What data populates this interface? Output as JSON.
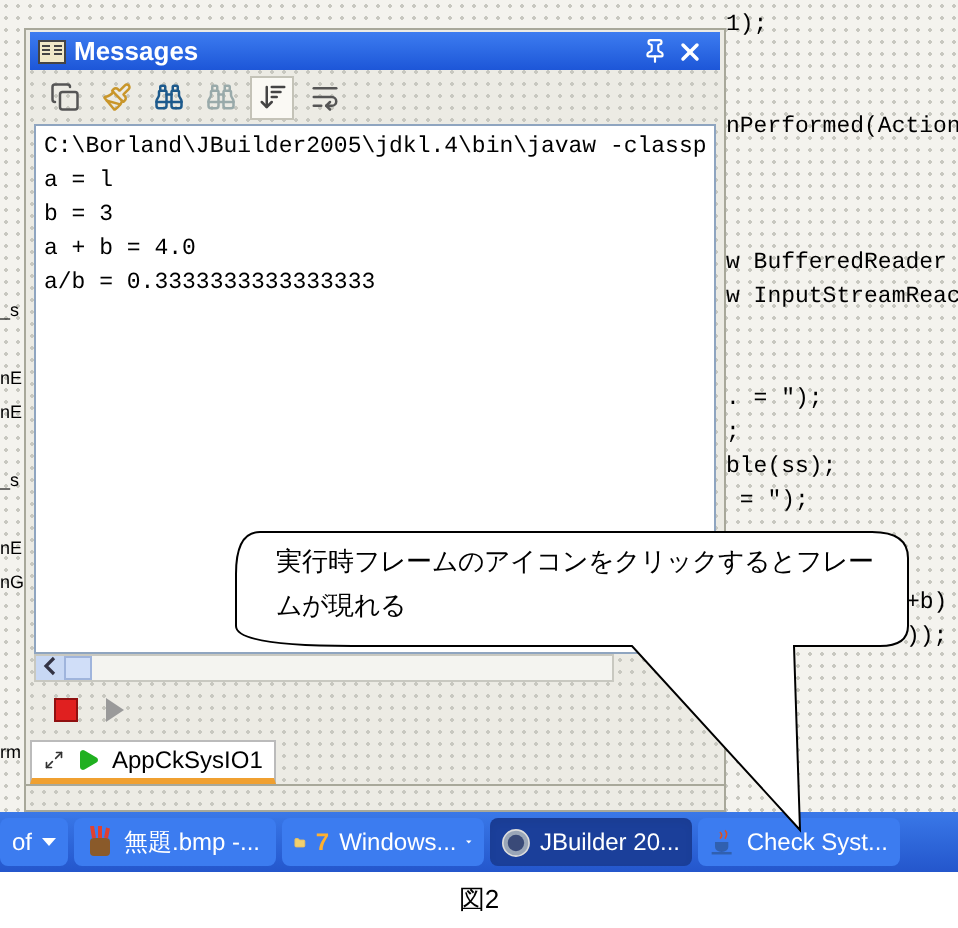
{
  "background_code": {
    "left_lines": [
      {
        "kind": "code",
        "text": "_s"
      },
      {
        "kind": "blank"
      },
      {
        "kind": "code",
        "text": "nE"
      },
      {
        "kind": "code",
        "text": "nE"
      },
      {
        "kind": "blank"
      },
      {
        "kind": "code",
        "text": "_s"
      },
      {
        "kind": "blank"
      },
      {
        "kind": "code",
        "text": "nE"
      },
      {
        "kind": "code",
        "text": "nG"
      },
      {
        "kind": "blank"
      },
      {
        "kind": "blank"
      },
      {
        "kind": "blank"
      },
      {
        "kind": "blank"
      },
      {
        "kind": "code",
        "text": "rm"
      }
    ],
    "right_lines": [
      {
        "kind": "code",
        "text": "1);"
      },
      {
        "kind": "blank"
      },
      {
        "kind": "blank"
      },
      {
        "kind": "code",
        "text": "nPerformed(Action"
      },
      {
        "kind": "blank"
      },
      {
        "kind": "blank"
      },
      {
        "kind": "blank"
      },
      {
        "kind": "code",
        "text": "w BufferedReader"
      },
      {
        "kind": "code",
        "text": "w InputStreamReac"
      },
      {
        "kind": "blank"
      },
      {
        "kind": "blank"
      },
      {
        "kind": "code",
        "text": ". = \");"
      },
      {
        "kind": "code",
        "text": ";"
      },
      {
        "kind": "code",
        "text": "ble(ss);"
      },
      {
        "kind": "code",
        "text": " = \");"
      },
      {
        "kind": "blank"
      },
      {
        "kind": "blank"
      },
      {
        "kind": "code",
        "text": "+b)",
        "behind_callout": true
      },
      {
        "kind": "code",
        "text": "));",
        "behind_callout": true
      }
    ]
  },
  "messages_window": {
    "title": "Messages",
    "toolbar": [
      {
        "kind": "copy",
        "selected": false
      },
      {
        "kind": "clear",
        "selected": false
      },
      {
        "kind": "find",
        "selected": false
      },
      {
        "kind": "find-next",
        "selected": false
      },
      {
        "kind": "sort",
        "selected": true
      },
      {
        "kind": "wrap",
        "selected": false
      }
    ],
    "output_lines": [
      "C:\\Borland\\JBuilder2005\\jdkl.4\\bin\\javaw -classp",
      "a = l",
      "b = 3",
      "a + b = 4.0",
      "a/b = 0.3333333333333333"
    ],
    "run_controls": [
      {
        "kind": "stop",
        "disabled": false
      },
      {
        "kind": "run",
        "disabled": true
      }
    ],
    "tabs": [
      {
        "label": "AppCkSysIO1",
        "selected": true
      }
    ]
  },
  "taskbar": [
    {
      "label": "of",
      "kind": "generic",
      "selected": false,
      "dropdown": true
    },
    {
      "label": "無題.bmp -...",
      "kind": "paint",
      "selected": false,
      "dropdown": false
    },
    {
      "label": "Windows...",
      "count": "7",
      "kind": "folder",
      "selected": false,
      "dropdown": true
    },
    {
      "label": "JBuilder 20...",
      "kind": "jbuilder",
      "selected": true,
      "dropdown": false
    },
    {
      "label": "Check Syst...",
      "kind": "java",
      "selected": false,
      "dropdown": false
    }
  ],
  "callout": {
    "text": "実行時フレームのアイコンをクリックするとフレームが現れる"
  },
  "caption": "図2"
}
